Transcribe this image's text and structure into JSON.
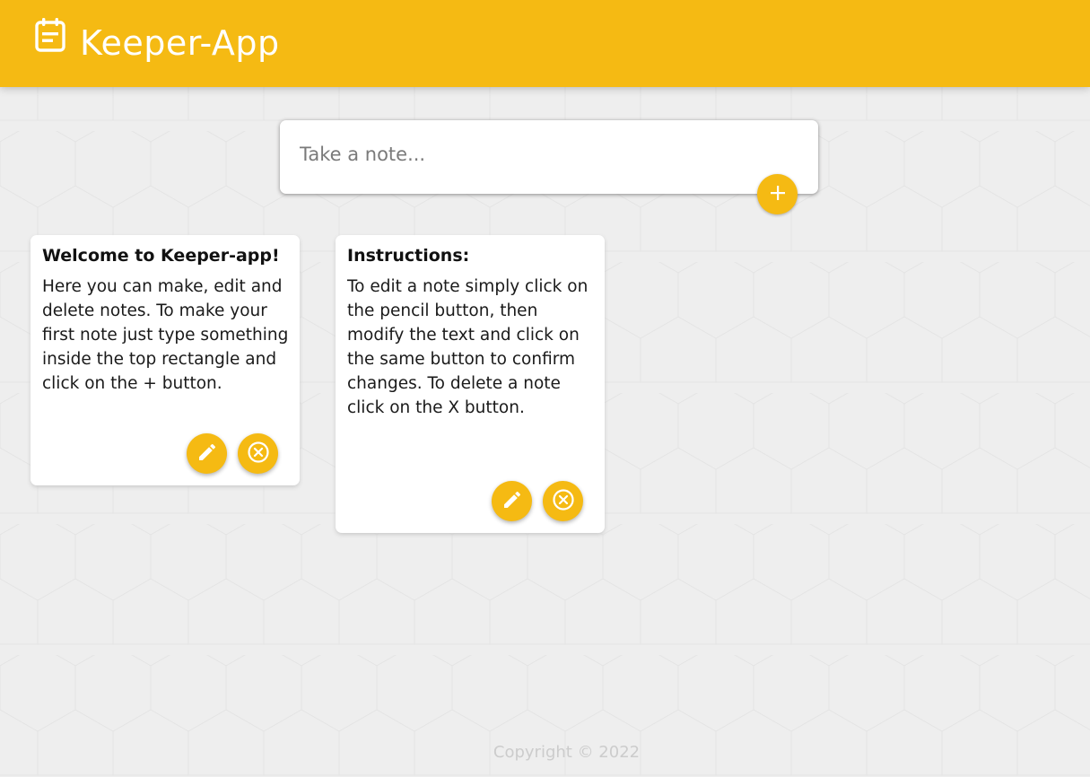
{
  "header": {
    "title": "Keeper-App",
    "logo_icon": "note-icon"
  },
  "create_note": {
    "placeholder": "Take a note...",
    "value": "",
    "add_icon": "plus-icon"
  },
  "notes": [
    {
      "title": "Welcome to Keeper-app!",
      "content": "Here you can make, edit and delete notes. To make your first note just type something inside the top rectangle and click on the + button.",
      "edit_icon": "pencil-icon",
      "delete_icon": "close-circle-icon"
    },
    {
      "title": "Instructions:",
      "content": "To edit a note simply click on the pencil button, then modify the text and click on the same button to confirm changes. To delete a note click on the X button.",
      "edit_icon": "pencil-icon",
      "delete_icon": "close-circle-icon"
    }
  ],
  "footer": {
    "text": "Copyright © 2022"
  },
  "colors": {
    "accent": "#f5ba13",
    "background": "#eeeeee",
    "card": "#ffffff",
    "footer_text": "#cccccc"
  }
}
